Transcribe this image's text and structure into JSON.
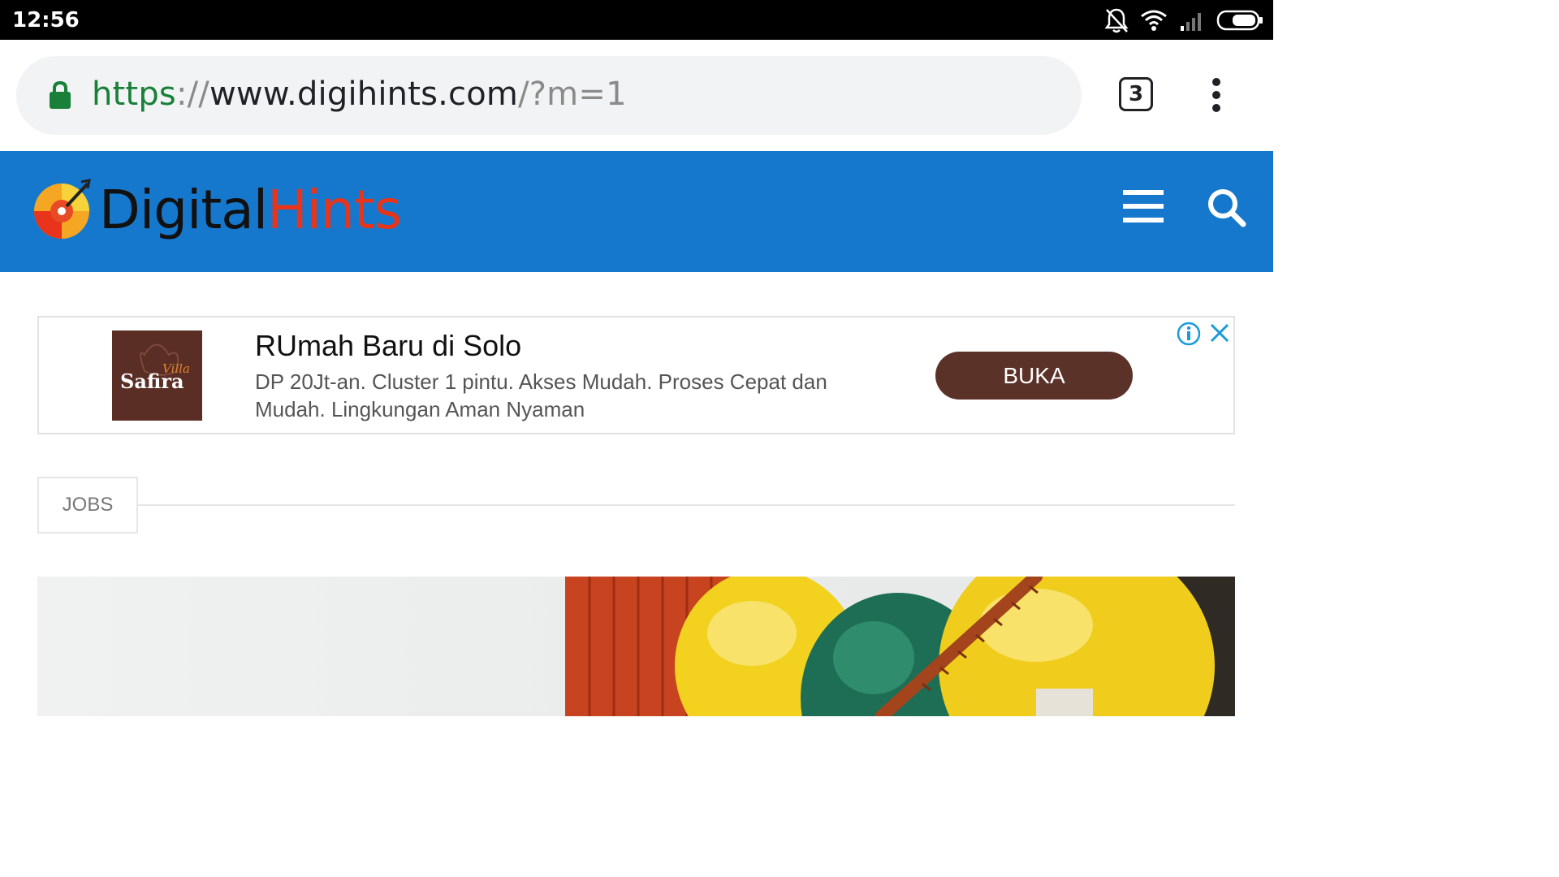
{
  "status_bar": {
    "time": "12:56",
    "icons": [
      "bell-off-icon",
      "wifi-icon",
      "signal-icon",
      "battery-icon"
    ]
  },
  "browser": {
    "url": {
      "scheme": "https",
      "separator": "://",
      "host": "www.digihints.com",
      "path": "/?m=1"
    },
    "tab_count": "3",
    "icons": [
      "lock-icon",
      "overflow-menu-icon"
    ]
  },
  "site": {
    "brand_color": "#1678cc",
    "logo_part1": "Digital",
    "logo_part2": "Hints",
    "icons": [
      "hamburger-menu-icon",
      "search-icon"
    ]
  },
  "ad": {
    "advertiser_logo_text": "Safira",
    "advertiser_logo_subtext": "Villa",
    "title": "RUmah Baru di Solo",
    "description": "DP 20Jt-an. Cluster 1 pintu. Akses Mudah. Proses Cepat dan Mudah. Lingkungan Aman Nyaman",
    "cta_label": "BUKA",
    "cta_color": "#5b3228",
    "icons": [
      "ad-info-icon",
      "ad-close-icon"
    ]
  },
  "category": {
    "label": "JOBS"
  }
}
